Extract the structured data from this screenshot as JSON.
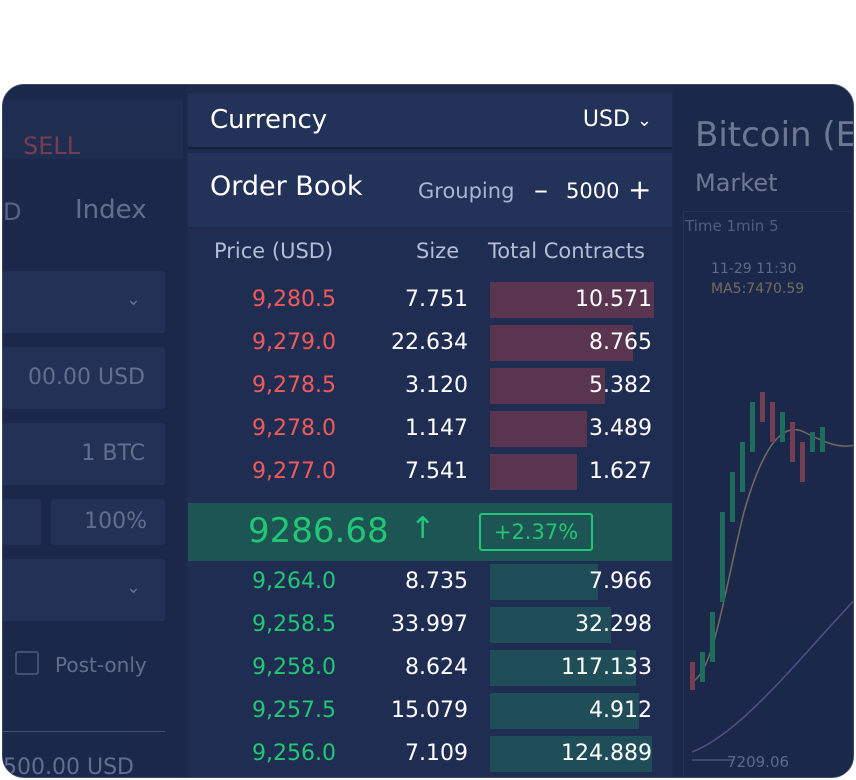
{
  "left_panel": {
    "sell_tab": "SELL",
    "index_tab_partial": "D",
    "index_tab": "Index",
    "amount_value": "00.00 USD",
    "quantity_value": "1 BTC",
    "percent_value": "100%",
    "post_only_label": "Post-only",
    "total_value": "500.00 USD"
  },
  "currency": {
    "label": "Currency",
    "selected": "USD"
  },
  "order_book": {
    "title": "Order Book",
    "grouping_label": "Grouping",
    "grouping_value": "5000",
    "columns": [
      "Price (USD)",
      "Size",
      "Total Contracts"
    ],
    "asks": [
      {
        "price": "9,280.5",
        "size": "7.751",
        "total": "10.571",
        "depth": 1.0
      },
      {
        "price": "9,279.0",
        "size": "22.634",
        "total": "8.765",
        "depth": 0.87
      },
      {
        "price": "9,278.5",
        "size": "3.120",
        "total": "5.382",
        "depth": 0.7
      },
      {
        "price": "9,278.0",
        "size": "1.147",
        "total": "3.489",
        "depth": 0.59
      },
      {
        "price": "9,277.0",
        "size": "7.541",
        "total": "1.627",
        "depth": 0.53
      }
    ],
    "last_price": "9286.68",
    "change": "+2.37%",
    "bids": [
      {
        "price": "9,264.0",
        "size": "8.735",
        "total": "7.966",
        "depth": 0.66
      },
      {
        "price": "9,258.5",
        "size": "33.997",
        "total": "32.298",
        "depth": 0.74
      },
      {
        "price": "9,258.0",
        "size": "8.624",
        "total": "117.133",
        "depth": 0.89
      },
      {
        "price": "9,257.5",
        "size": "15.079",
        "total": "4.912",
        "depth": 0.91
      },
      {
        "price": "9,256.0",
        "size": "7.109",
        "total": "124.889",
        "depth": 0.99
      }
    ]
  },
  "right_panel": {
    "title": "Bitcoin (E",
    "market_tab": "Market",
    "chart_tabs": "Time   1min   5",
    "time_label": "11-29 11:30",
    "ma_label": "MA5:7470.59",
    "low_label": "7209.06"
  },
  "colors": {
    "ask": "#f25a5a",
    "bid": "#21c774",
    "panel": "#233258",
    "background": "#1d2a4c"
  }
}
